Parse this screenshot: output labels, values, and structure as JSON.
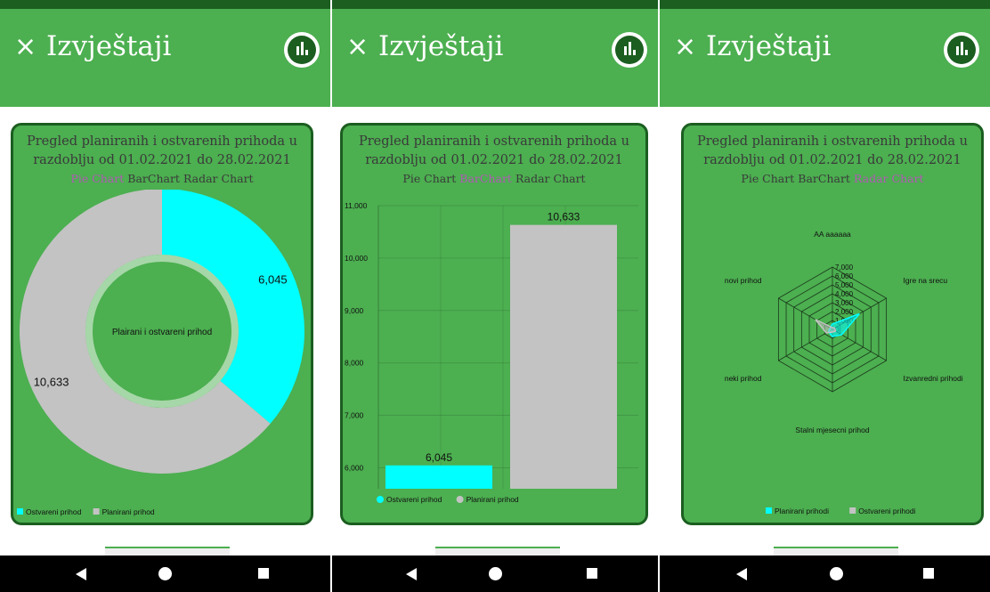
{
  "app": {
    "close_glyph": "×",
    "title": "Izvještaji",
    "chart_icon": "bar-chart-icon"
  },
  "report": {
    "title_line1": "Pregled planiranih i ostvarenih prihoda u",
    "title_line2": "razdoblju od 01.02.2021 do 28.02.2021"
  },
  "tabs": [
    "Pie Chart",
    "BarChart",
    "Radar Chart"
  ],
  "colors": {
    "header": "#4caf50",
    "dark": "#1b5e20",
    "cyan": "#00ffff",
    "gray": "#c3c3c3",
    "active_tab": "#b15ab5"
  },
  "chart_data": [
    {
      "type": "pie",
      "active_tab": "Pie Chart",
      "center_text": "Plairani i ostvareni prihod",
      "slices": [
        {
          "label": "Ostvareni prihod",
          "value": 6045,
          "value_label": "6,045",
          "color": "#00ffff"
        },
        {
          "label": "Planirani prihod",
          "value": 10633,
          "value_label": "10,633",
          "color": "#c3c3c3"
        }
      ],
      "legend": [
        "Ostvareni prihod",
        "Planirani prihod"
      ],
      "legend_position": "bottom-left"
    },
    {
      "type": "bar",
      "active_tab": "BarChart",
      "ylim": [
        5600,
        11000
      ],
      "yticks": [
        6000,
        7000,
        8000,
        9000,
        10000,
        11000
      ],
      "ytick_labels": [
        "6,000",
        "7,000",
        "8,000",
        "9,000",
        "10,000",
        "11,000"
      ],
      "bars": [
        {
          "label": "Ostvareni prihod",
          "value": 6045,
          "value_label": "6,045",
          "color": "#00ffff"
        },
        {
          "label": "Planirani prihod",
          "value": 10633,
          "value_label": "10,633",
          "color": "#c3c3c3"
        }
      ],
      "legend": [
        "Ostvareni prihod",
        "Planirani prihod"
      ],
      "grid": true,
      "legend_position": "bottom-left"
    },
    {
      "type": "radar",
      "active_tab": "Radar Chart",
      "axes": [
        "AA aaaaaa",
        "Igre na srecu",
        "Izvanredni prihodi",
        "Stalni mjesecni prihod",
        "neki prihod",
        "novi prihod"
      ],
      "rlim": [
        0,
        7000
      ],
      "rticks": [
        0,
        1000,
        2000,
        3000,
        4000,
        5000,
        6000,
        7000
      ],
      "rtick_labels": [
        "0",
        "1,000",
        "2,000",
        "3,000",
        "4,000",
        "5,000",
        "6,000",
        "7,000"
      ],
      "series": [
        {
          "name": "Planirani prihodi",
          "values": [
            600,
            3500,
            1200,
            800,
            500,
            300
          ],
          "color": "#00ffff"
        },
        {
          "name": "Ostvareni prihodi",
          "values": [
            200,
            300,
            400,
            300,
            800,
            2200
          ],
          "color": "#c3c3c3"
        }
      ],
      "legend": [
        "Planirani prihodi",
        "Ostvareni prihodi"
      ],
      "legend_position": "bottom-center"
    }
  ]
}
